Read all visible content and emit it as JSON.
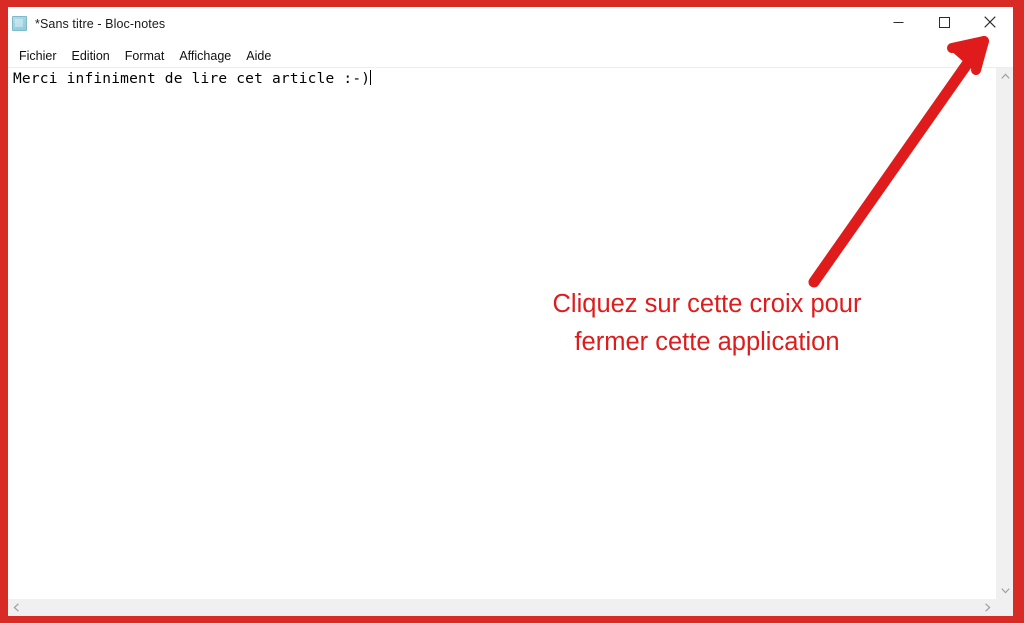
{
  "window": {
    "title": "*Sans titre - Bloc-notes",
    "app_icon": "notepad-icon",
    "controls": {
      "minimize_label": "Réduire",
      "maximize_label": "Agrandir",
      "close_label": "Fermer"
    }
  },
  "menubar": {
    "items": [
      {
        "label": "Fichier"
      },
      {
        "label": "Edition"
      },
      {
        "label": "Format"
      },
      {
        "label": "Affichage"
      },
      {
        "label": "Aide"
      }
    ]
  },
  "document": {
    "content": "Merci infiniment de lire cet article :-)"
  },
  "scrollbars": {
    "vertical": {
      "up_icon": "chevron-up-icon",
      "down_icon": "chevron-down-icon"
    },
    "horizontal": {
      "left_icon": "chevron-left-icon",
      "right_icon": "chevron-right-icon"
    }
  },
  "annotation": {
    "text": "Cliquez sur cette croix pour\nfermer cette application",
    "arrow_icon": "arrow-pointing-up-right-icon",
    "color": "#e01b1b"
  },
  "colors": {
    "frame_red": "#d82b26",
    "annotation_red": "#e01b1b",
    "window_background": "#ffffff",
    "scrollbar_track": "#f0f0f0",
    "text_black": "#000000"
  }
}
